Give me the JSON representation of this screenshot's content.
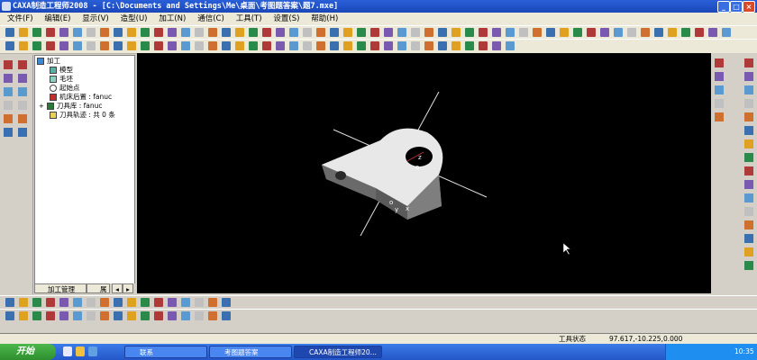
{
  "window": {
    "title": "CAXA制造工程师2008  - [C:\\Documents and Settings\\Me\\桌面\\考图题答案\\题7.mxe]",
    "min": "_",
    "max": "□",
    "close": "×"
  },
  "menu": [
    "文件(F)",
    "编辑(E)",
    "显示(V)",
    "造型(U)",
    "加工(N)",
    "通信(C)",
    "工具(T)",
    "设置(S)",
    "帮助(H)"
  ],
  "tree": {
    "items": [
      {
        "label": "加工"
      },
      {
        "label": "模型"
      },
      {
        "label": "毛坯"
      },
      {
        "label": "起始点"
      },
      {
        "label": "机床后置 : fanuc"
      },
      {
        "label": "刀具库 : fanuc"
      },
      {
        "label": "刀具轨迹 : 共 0 条"
      }
    ],
    "tabs": [
      "加工管理",
      "属"
    ]
  },
  "viewport": {
    "axis_labels": [
      "z",
      "o",
      "o",
      "y",
      "x"
    ]
  },
  "status": {
    "mode": "工具状态",
    "coords": "97.617,-10.225,0.000"
  },
  "taskbar": {
    "start": "开始",
    "tasks": [
      "联系",
      "考图题答案",
      "CAXA制造工程师20..."
    ],
    "clock": "10:35"
  },
  "colors": {
    "titlebar": "#1a47b8",
    "viewport_bg": "#000000",
    "taskbar": "#2456c8",
    "start": "#2e8e2e"
  }
}
